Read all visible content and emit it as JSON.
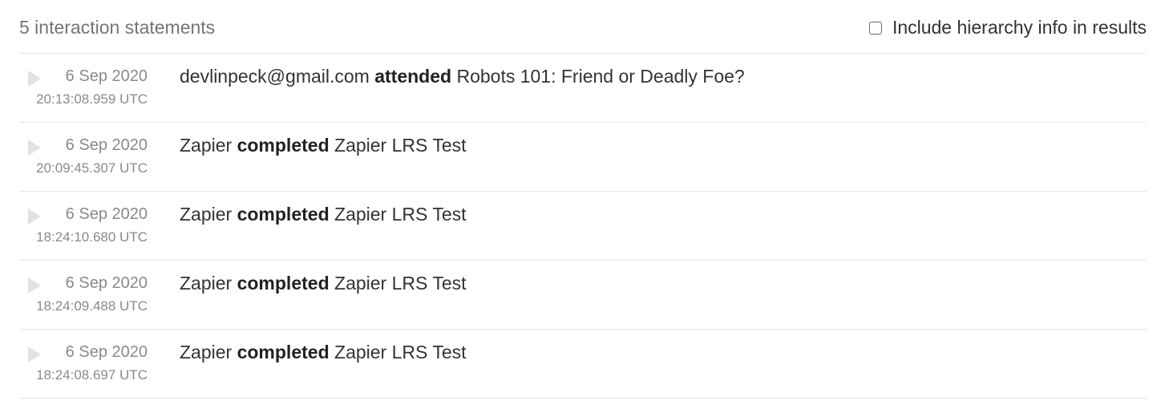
{
  "header": {
    "count_label": "5 interaction statements",
    "hierarchy_label": "Include hierarchy info in results",
    "hierarchy_checked": false
  },
  "statements": [
    {
      "date": "6 Sep 2020",
      "time": "20:13:08.959 UTC",
      "actor": "devlinpeck@gmail.com",
      "verb": "attended",
      "object": "Robots 101: Friend or Deadly Foe?"
    },
    {
      "date": "6 Sep 2020",
      "time": "20:09:45.307 UTC",
      "actor": "Zapier",
      "verb": "completed",
      "object": "Zapier LRS Test"
    },
    {
      "date": "6 Sep 2020",
      "time": "18:24:10.680 UTC",
      "actor": "Zapier",
      "verb": "completed",
      "object": "Zapier LRS Test"
    },
    {
      "date": "6 Sep 2020",
      "time": "18:24:09.488 UTC",
      "actor": "Zapier",
      "verb": "completed",
      "object": "Zapier LRS Test"
    },
    {
      "date": "6 Sep 2020",
      "time": "18:24:08.697 UTC",
      "actor": "Zapier",
      "verb": "completed",
      "object": "Zapier LRS Test"
    }
  ],
  "icons": {
    "expand": "play-triangle-icon"
  },
  "colors": {
    "muted_text": "#8a8a8a",
    "divider": "#e6e6e6",
    "expand_icon": "#e2e2e2"
  }
}
